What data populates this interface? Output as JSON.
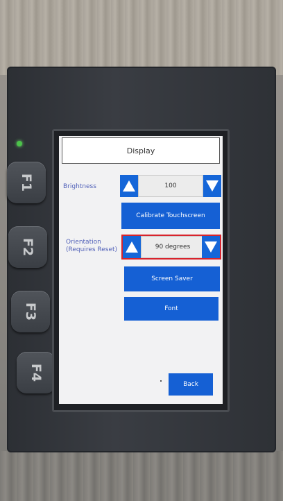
{
  "device": {
    "function_keys": [
      "F1",
      "F2",
      "F3",
      "F4"
    ]
  },
  "screen": {
    "title": "Display",
    "brightness": {
      "label": "Brightness",
      "value": "100"
    },
    "calibrate_label": "Calibrate Touchscreen",
    "orientation": {
      "label_line1": "Orientation",
      "label_line2": "(Requires Reset)",
      "value": "90 degrees"
    },
    "screen_saver_label": "Screen Saver",
    "font_label": "Font",
    "back_label": "Back"
  },
  "colors": {
    "button_blue": "#1560d4",
    "highlight_red": "#d8242c",
    "status_led": "#4cc34a"
  }
}
